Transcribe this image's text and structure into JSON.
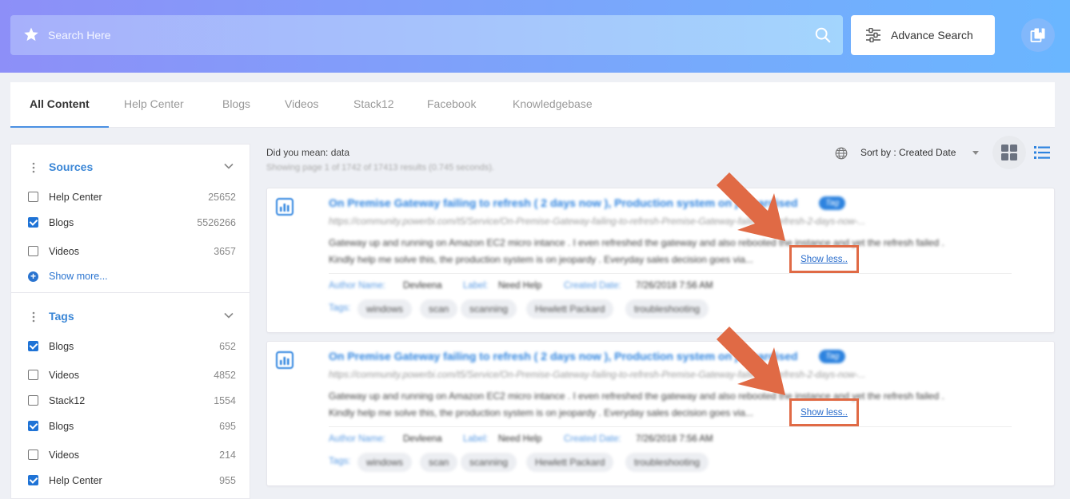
{
  "search": {
    "placeholder": "Search Here"
  },
  "header": {
    "advance_search_label": "Advance Search"
  },
  "tabs": [
    {
      "label": "All Content",
      "active": true
    },
    {
      "label": "Help Center"
    },
    {
      "label": "Blogs"
    },
    {
      "label": "Videos"
    },
    {
      "label": "Stack12"
    },
    {
      "label": "Facebook"
    },
    {
      "label": "Knowledgebase"
    }
  ],
  "sidebar": {
    "sources": {
      "title": "Sources",
      "items": [
        {
          "label": "Help Center",
          "count": "25652",
          "checked": false
        },
        {
          "label": "Blogs",
          "count": "5526266",
          "checked": true
        },
        {
          "label": "Videos",
          "count": "3657",
          "checked": false
        }
      ],
      "show_more": "Show more..."
    },
    "tags": {
      "title": "Tags",
      "items": [
        {
          "label": "Blogs",
          "count": "652",
          "checked": true
        },
        {
          "label": "Videos",
          "count": "4852",
          "checked": false
        },
        {
          "label": "Stack12",
          "count": "1554",
          "checked": false
        },
        {
          "label": "Blogs",
          "count": "695",
          "checked": true
        },
        {
          "label": "Videos",
          "count": "214",
          "checked": false
        },
        {
          "label": "Help Center",
          "count": "955",
          "checked": true
        }
      ]
    }
  },
  "results_meta": {
    "did_you_mean": "Did you mean: data",
    "showing": "Showing page 1 of 1742 of 17413 results (0.745 seconds).",
    "sort_label": "Sort by : Created Date"
  },
  "results": [
    {
      "title": "On Premise Gateway failing to refresh ( 2 days now ), Production system on jeopardised",
      "tag_badge": "Tag",
      "url": "https://community.powerbi.com/t5/Service/On-Premise-Gateway-failing-to-refresh-Premise-Gateway-failing-to-refresh-2-days-now-...",
      "desc_line1": "Gateway up and running on Amazon EC2 micro intance . I even refreshed the gateway and also rebooted the instance and yet the refresh failed .",
      "desc_line2": "Kindly help me solve this, the production system is on jeopardy . Everyday sales decision goes via...",
      "show_less": "Show less..",
      "author_key": "Author Name:",
      "author_val": "Devleena",
      "label_key": "Label:",
      "label_val": "Need Help",
      "date_key": "Created Date:",
      "date_val": "7/26/2018 7:56 AM",
      "tags_key": "Tags:",
      "tags": [
        "windows",
        "scan",
        "scanning",
        "Hewlett Packard",
        "troubleshooting"
      ]
    },
    {
      "title": "On Premise Gateway failing to refresh ( 2 days now ), Production system on jeopardised",
      "tag_badge": "Tag",
      "url": "https://community.powerbi.com/t5/Service/On-Premise-Gateway-failing-to-refresh-Premise-Gateway-failing-to-refresh-2-days-now-...",
      "desc_line1": "Gateway up and running on Amazon EC2 micro intance . I even refreshed the gateway and also rebooted the instance and yet the refresh failed .",
      "desc_line2": "Kindly help me solve this, the production system is on jeopardy . Everyday sales decision goes via...",
      "show_less": "Show less..",
      "author_key": "Author Name:",
      "author_val": "Devleena",
      "label_key": "Label:",
      "label_val": "Need Help",
      "date_key": "Created Date:",
      "date_val": "7/26/2018 7:56 AM",
      "tags_key": "Tags:",
      "tags": [
        "windows",
        "scan",
        "scanning",
        "Hewlett Packard",
        "troubleshooting"
      ]
    }
  ],
  "colors": {
    "accent": "#2d83df",
    "annotation": "#e06a45",
    "header_start": "#8d8ff8",
    "header_end": "#6ab6ff"
  }
}
